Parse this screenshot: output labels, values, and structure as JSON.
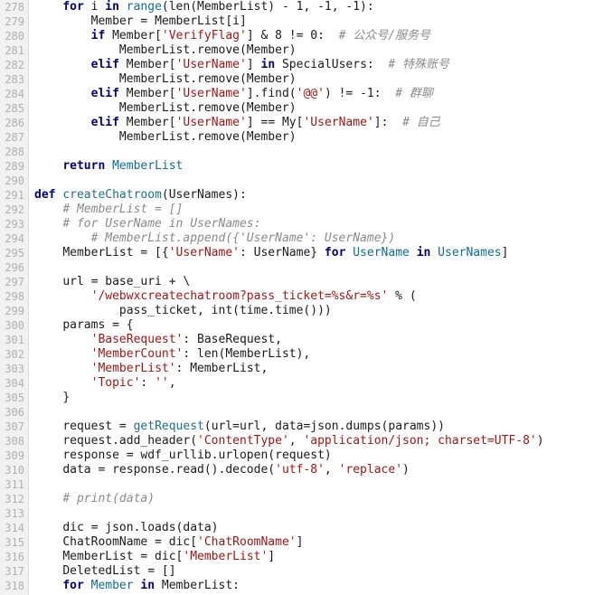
{
  "editor": {
    "lines": [
      {
        "n": "278",
        "indent": "    ",
        "t": [
          {
            "c": "kw",
            "v": "for"
          },
          {
            "c": "",
            "v": " i "
          },
          {
            "c": "kw",
            "v": "in"
          },
          {
            "c": "",
            "v": " "
          },
          {
            "c": "bi",
            "v": "range"
          },
          {
            "c": "",
            "v": "(len(MemberList) - 1, -1, -1):"
          }
        ]
      },
      {
        "n": "279",
        "indent": "        ",
        "t": [
          {
            "c": "",
            "v": "Member = MemberList[i]"
          }
        ]
      },
      {
        "n": "280",
        "indent": "        ",
        "t": [
          {
            "c": "kw",
            "v": "if"
          },
          {
            "c": "",
            "v": " Member["
          },
          {
            "c": "st",
            "v": "'VerifyFlag'"
          },
          {
            "c": "",
            "v": "] & 8 != 0:  "
          },
          {
            "c": "cm",
            "v": "# 公众号/服务号"
          }
        ]
      },
      {
        "n": "281",
        "indent": "            ",
        "t": [
          {
            "c": "",
            "v": "MemberList.remove(Member)"
          }
        ]
      },
      {
        "n": "282",
        "indent": "        ",
        "t": [
          {
            "c": "kw",
            "v": "elif"
          },
          {
            "c": "",
            "v": " Member["
          },
          {
            "c": "st",
            "v": "'UserName'"
          },
          {
            "c": "",
            "v": "] "
          },
          {
            "c": "kw",
            "v": "in"
          },
          {
            "c": "",
            "v": " SpecialUsers:  "
          },
          {
            "c": "cm",
            "v": "# 特殊账号"
          }
        ]
      },
      {
        "n": "283",
        "indent": "            ",
        "t": [
          {
            "c": "",
            "v": "MemberList.remove(Member)"
          }
        ]
      },
      {
        "n": "284",
        "indent": "        ",
        "t": [
          {
            "c": "kw",
            "v": "elif"
          },
          {
            "c": "",
            "v": " Member["
          },
          {
            "c": "st",
            "v": "'UserName'"
          },
          {
            "c": "",
            "v": "].find("
          },
          {
            "c": "st",
            "v": "'@@'"
          },
          {
            "c": "",
            "v": ") != -1:  "
          },
          {
            "c": "cm",
            "v": "# 群聊"
          }
        ]
      },
      {
        "n": "285",
        "indent": "            ",
        "t": [
          {
            "c": "",
            "v": "MemberList.remove(Member)"
          }
        ]
      },
      {
        "n": "286",
        "indent": "        ",
        "t": [
          {
            "c": "kw",
            "v": "elif"
          },
          {
            "c": "",
            "v": " Member["
          },
          {
            "c": "st",
            "v": "'UserName'"
          },
          {
            "c": "",
            "v": "] == My["
          },
          {
            "c": "st",
            "v": "'UserName'"
          },
          {
            "c": "",
            "v": "]:  "
          },
          {
            "c": "cm",
            "v": "# 自己"
          }
        ]
      },
      {
        "n": "287",
        "indent": "            ",
        "t": [
          {
            "c": "",
            "v": "MemberList.remove(Member)"
          }
        ]
      },
      {
        "n": "288",
        "indent": "",
        "t": []
      },
      {
        "n": "289",
        "indent": "    ",
        "t": [
          {
            "c": "kw",
            "v": "return"
          },
          {
            "c": "",
            "v": " "
          },
          {
            "c": "nm",
            "v": "MemberList"
          }
        ]
      },
      {
        "n": "290",
        "indent": "",
        "t": []
      },
      {
        "n": "291",
        "indent": "",
        "t": [
          {
            "c": "kw",
            "v": "def"
          },
          {
            "c": "",
            "v": " "
          },
          {
            "c": "fn",
            "v": "createChatroom"
          },
          {
            "c": "",
            "v": "(UserNames):"
          }
        ]
      },
      {
        "n": "292",
        "indent": "    ",
        "t": [
          {
            "c": "cm",
            "v": "# MemberList = []"
          }
        ]
      },
      {
        "n": "293",
        "indent": "    ",
        "t": [
          {
            "c": "cm",
            "v": "# for UserName in UserNames:"
          }
        ]
      },
      {
        "n": "294",
        "indent": "        ",
        "t": [
          {
            "c": "cm",
            "v": "# MemberList.append({'UserName': UserName})"
          }
        ]
      },
      {
        "n": "295",
        "indent": "    ",
        "t": [
          {
            "c": "",
            "v": "MemberList = [{"
          },
          {
            "c": "st",
            "v": "'UserName'"
          },
          {
            "c": "",
            "v": ": UserName} "
          },
          {
            "c": "kw",
            "v": "for"
          },
          {
            "c": "",
            "v": " "
          },
          {
            "c": "nm",
            "v": "UserName"
          },
          {
            "c": "",
            "v": " "
          },
          {
            "c": "kw",
            "v": "in"
          },
          {
            "c": "",
            "v": " "
          },
          {
            "c": "nm",
            "v": "UserNames"
          },
          {
            "c": "",
            "v": "]"
          }
        ]
      },
      {
        "n": "296",
        "indent": "",
        "t": []
      },
      {
        "n": "297",
        "indent": "    ",
        "t": [
          {
            "c": "",
            "v": "url = base_uri + \\"
          }
        ]
      },
      {
        "n": "298",
        "indent": "        ",
        "t": [
          {
            "c": "st",
            "v": "'/webwxcreatechatroom?pass_ticket=%s&r=%s'"
          },
          {
            "c": "",
            "v": " % ("
          }
        ]
      },
      {
        "n": "299",
        "indent": "            ",
        "t": [
          {
            "c": "",
            "v": "pass_ticket, int(time.time()))"
          }
        ]
      },
      {
        "n": "300",
        "indent": "    ",
        "t": [
          {
            "c": "",
            "v": "params = {"
          }
        ]
      },
      {
        "n": "301",
        "indent": "        ",
        "t": [
          {
            "c": "st",
            "v": "'BaseRequest'"
          },
          {
            "c": "",
            "v": ": BaseRequest,"
          }
        ]
      },
      {
        "n": "302",
        "indent": "        ",
        "t": [
          {
            "c": "st",
            "v": "'MemberCount'"
          },
          {
            "c": "",
            "v": ": len(MemberList),"
          }
        ]
      },
      {
        "n": "303",
        "indent": "        ",
        "t": [
          {
            "c": "st",
            "v": "'MemberList'"
          },
          {
            "c": "",
            "v": ": MemberList,"
          }
        ]
      },
      {
        "n": "304",
        "indent": "        ",
        "t": [
          {
            "c": "st",
            "v": "'Topic'"
          },
          {
            "c": "",
            "v": ": "
          },
          {
            "c": "st",
            "v": "''"
          },
          {
            "c": "",
            "v": ","
          }
        ]
      },
      {
        "n": "305",
        "indent": "    ",
        "t": [
          {
            "c": "",
            "v": "}"
          }
        ]
      },
      {
        "n": "306",
        "indent": "",
        "t": []
      },
      {
        "n": "307",
        "indent": "    ",
        "t": [
          {
            "c": "",
            "v": "request = "
          },
          {
            "c": "fn",
            "v": "getRequest"
          },
          {
            "c": "",
            "v": "(url=url, data=json.dumps(params))"
          }
        ]
      },
      {
        "n": "308",
        "indent": "    ",
        "t": [
          {
            "c": "",
            "v": "request.add_header("
          },
          {
            "c": "st",
            "v": "'ContentType'"
          },
          {
            "c": "",
            "v": ", "
          },
          {
            "c": "st",
            "v": "'application/json; charset=UTF-8'"
          },
          {
            "c": "",
            "v": ")"
          }
        ]
      },
      {
        "n": "309",
        "indent": "    ",
        "t": [
          {
            "c": "",
            "v": "response = wdf_urllib.urlopen(request)"
          }
        ]
      },
      {
        "n": "310",
        "indent": "    ",
        "t": [
          {
            "c": "",
            "v": "data = response.read().decode("
          },
          {
            "c": "st",
            "v": "'utf-8'"
          },
          {
            "c": "",
            "v": ", "
          },
          {
            "c": "st",
            "v": "'replace'"
          },
          {
            "c": "",
            "v": ")"
          }
        ]
      },
      {
        "n": "311",
        "indent": "",
        "t": []
      },
      {
        "n": "312",
        "indent": "    ",
        "t": [
          {
            "c": "cm",
            "v": "# print(data)"
          }
        ]
      },
      {
        "n": "313",
        "indent": "",
        "t": []
      },
      {
        "n": "314",
        "indent": "    ",
        "t": [
          {
            "c": "",
            "v": "dic = json.loads(data)"
          }
        ]
      },
      {
        "n": "315",
        "indent": "    ",
        "t": [
          {
            "c": "",
            "v": "ChatRoomName = dic["
          },
          {
            "c": "st",
            "v": "'ChatRoomName'"
          },
          {
            "c": "",
            "v": "]"
          }
        ]
      },
      {
        "n": "316",
        "indent": "    ",
        "t": [
          {
            "c": "",
            "v": "MemberList = dic["
          },
          {
            "c": "st",
            "v": "'MemberList'"
          },
          {
            "c": "",
            "v": "]"
          }
        ]
      },
      {
        "n": "317",
        "indent": "    ",
        "t": [
          {
            "c": "",
            "v": "DeletedList = []"
          }
        ]
      },
      {
        "n": "318",
        "indent": "    ",
        "t": [
          {
            "c": "kw",
            "v": "for"
          },
          {
            "c": "",
            "v": " "
          },
          {
            "c": "nm",
            "v": "Member"
          },
          {
            "c": "",
            "v": " "
          },
          {
            "c": "kw",
            "v": "in"
          },
          {
            "c": "",
            "v": " MemberList:"
          }
        ]
      }
    ]
  },
  "colors": {
    "background": "#ffffff",
    "gutter": "#f1f1f1",
    "keyword": "#000080",
    "string": "#a31515",
    "comment": "#8a8a8a",
    "name": "#0e6b95"
  }
}
